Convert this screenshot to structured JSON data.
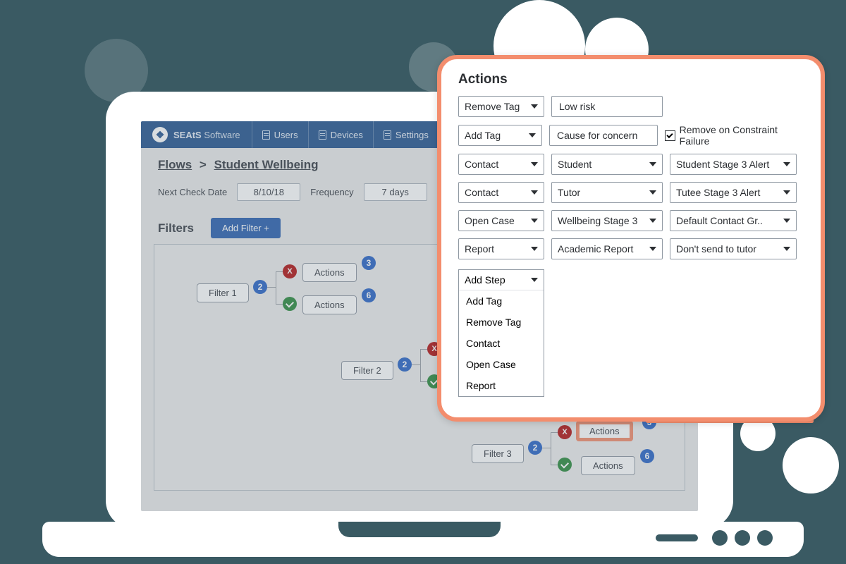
{
  "brand": {
    "bold": "SEAtS",
    "light": "Software"
  },
  "nav": {
    "users": "Users",
    "devices": "Devices",
    "settings": "Settings"
  },
  "crumbs": {
    "root": "Flows",
    "sep": ">",
    "current": "Student Wellbeing"
  },
  "cfg": {
    "next_check_label": "Next Check Date",
    "next_check_value": "8/10/18",
    "frequency_label": "Frequency",
    "frequency_value": "7 days"
  },
  "filters": {
    "title": "Filters",
    "add_btn": "Add Filter +"
  },
  "flow": {
    "filter1": "Filter 1",
    "filter2": "Filter 2",
    "filter3": "Filter 3",
    "actions": "Actions",
    "b2": "2",
    "b3": "3",
    "b6": "6",
    "x": "X"
  },
  "popup": {
    "title": "Actions",
    "rows": [
      {
        "a": "Remove Tag",
        "b": "Low risk"
      },
      {
        "a": "Add Tag",
        "b": "Cause for concern",
        "chk": "Remove on Constraint Failure"
      },
      {
        "a": "Contact",
        "b": "Student",
        "c": "Student Stage 3 Alert"
      },
      {
        "a": "Contact",
        "b": "Tutor",
        "c": "Tutee Stage 3 Alert"
      },
      {
        "a": "Open Case",
        "b": "Wellbeing Stage 3",
        "c": "Default Contact Gr.."
      },
      {
        "a": "Report",
        "b": "Academic Report",
        "c": "Don't send to tutor"
      }
    ],
    "menu": {
      "head": "Add Step",
      "opts": [
        "Add Tag",
        "Remove Tag",
        "Contact",
        "Open Case",
        "Report"
      ]
    }
  }
}
